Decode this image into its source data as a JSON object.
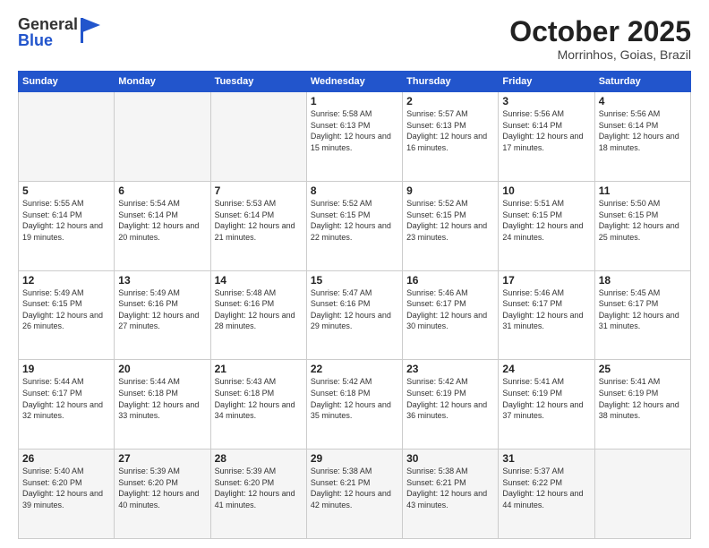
{
  "logo": {
    "text_general": "General",
    "text_blue": "Blue"
  },
  "header": {
    "title": "October 2025",
    "subtitle": "Morrinhos, Goias, Brazil"
  },
  "weekdays": [
    "Sunday",
    "Monday",
    "Tuesday",
    "Wednesday",
    "Thursday",
    "Friday",
    "Saturday"
  ],
  "weeks": [
    [
      {
        "day": "",
        "info": ""
      },
      {
        "day": "",
        "info": ""
      },
      {
        "day": "",
        "info": ""
      },
      {
        "day": "1",
        "info": "Sunrise: 5:58 AM\nSunset: 6:13 PM\nDaylight: 12 hours and 15 minutes."
      },
      {
        "day": "2",
        "info": "Sunrise: 5:57 AM\nSunset: 6:13 PM\nDaylight: 12 hours and 16 minutes."
      },
      {
        "day": "3",
        "info": "Sunrise: 5:56 AM\nSunset: 6:14 PM\nDaylight: 12 hours and 17 minutes."
      },
      {
        "day": "4",
        "info": "Sunrise: 5:56 AM\nSunset: 6:14 PM\nDaylight: 12 hours and 18 minutes."
      }
    ],
    [
      {
        "day": "5",
        "info": "Sunrise: 5:55 AM\nSunset: 6:14 PM\nDaylight: 12 hours and 19 minutes."
      },
      {
        "day": "6",
        "info": "Sunrise: 5:54 AM\nSunset: 6:14 PM\nDaylight: 12 hours and 20 minutes."
      },
      {
        "day": "7",
        "info": "Sunrise: 5:53 AM\nSunset: 6:14 PM\nDaylight: 12 hours and 21 minutes."
      },
      {
        "day": "8",
        "info": "Sunrise: 5:52 AM\nSunset: 6:15 PM\nDaylight: 12 hours and 22 minutes."
      },
      {
        "day": "9",
        "info": "Sunrise: 5:52 AM\nSunset: 6:15 PM\nDaylight: 12 hours and 23 minutes."
      },
      {
        "day": "10",
        "info": "Sunrise: 5:51 AM\nSunset: 6:15 PM\nDaylight: 12 hours and 24 minutes."
      },
      {
        "day": "11",
        "info": "Sunrise: 5:50 AM\nSunset: 6:15 PM\nDaylight: 12 hours and 25 minutes."
      }
    ],
    [
      {
        "day": "12",
        "info": "Sunrise: 5:49 AM\nSunset: 6:15 PM\nDaylight: 12 hours and 26 minutes."
      },
      {
        "day": "13",
        "info": "Sunrise: 5:49 AM\nSunset: 6:16 PM\nDaylight: 12 hours and 27 minutes."
      },
      {
        "day": "14",
        "info": "Sunrise: 5:48 AM\nSunset: 6:16 PM\nDaylight: 12 hours and 28 minutes."
      },
      {
        "day": "15",
        "info": "Sunrise: 5:47 AM\nSunset: 6:16 PM\nDaylight: 12 hours and 29 minutes."
      },
      {
        "day": "16",
        "info": "Sunrise: 5:46 AM\nSunset: 6:17 PM\nDaylight: 12 hours and 30 minutes."
      },
      {
        "day": "17",
        "info": "Sunrise: 5:46 AM\nSunset: 6:17 PM\nDaylight: 12 hours and 31 minutes."
      },
      {
        "day": "18",
        "info": "Sunrise: 5:45 AM\nSunset: 6:17 PM\nDaylight: 12 hours and 31 minutes."
      }
    ],
    [
      {
        "day": "19",
        "info": "Sunrise: 5:44 AM\nSunset: 6:17 PM\nDaylight: 12 hours and 32 minutes."
      },
      {
        "day": "20",
        "info": "Sunrise: 5:44 AM\nSunset: 6:18 PM\nDaylight: 12 hours and 33 minutes."
      },
      {
        "day": "21",
        "info": "Sunrise: 5:43 AM\nSunset: 6:18 PM\nDaylight: 12 hours and 34 minutes."
      },
      {
        "day": "22",
        "info": "Sunrise: 5:42 AM\nSunset: 6:18 PM\nDaylight: 12 hours and 35 minutes."
      },
      {
        "day": "23",
        "info": "Sunrise: 5:42 AM\nSunset: 6:19 PM\nDaylight: 12 hours and 36 minutes."
      },
      {
        "day": "24",
        "info": "Sunrise: 5:41 AM\nSunset: 6:19 PM\nDaylight: 12 hours and 37 minutes."
      },
      {
        "day": "25",
        "info": "Sunrise: 5:41 AM\nSunset: 6:19 PM\nDaylight: 12 hours and 38 minutes."
      }
    ],
    [
      {
        "day": "26",
        "info": "Sunrise: 5:40 AM\nSunset: 6:20 PM\nDaylight: 12 hours and 39 minutes."
      },
      {
        "day": "27",
        "info": "Sunrise: 5:39 AM\nSunset: 6:20 PM\nDaylight: 12 hours and 40 minutes."
      },
      {
        "day": "28",
        "info": "Sunrise: 5:39 AM\nSunset: 6:20 PM\nDaylight: 12 hours and 41 minutes."
      },
      {
        "day": "29",
        "info": "Sunrise: 5:38 AM\nSunset: 6:21 PM\nDaylight: 12 hours and 42 minutes."
      },
      {
        "day": "30",
        "info": "Sunrise: 5:38 AM\nSunset: 6:21 PM\nDaylight: 12 hours and 43 minutes."
      },
      {
        "day": "31",
        "info": "Sunrise: 5:37 AM\nSunset: 6:22 PM\nDaylight: 12 hours and 44 minutes."
      },
      {
        "day": "",
        "info": ""
      }
    ]
  ]
}
